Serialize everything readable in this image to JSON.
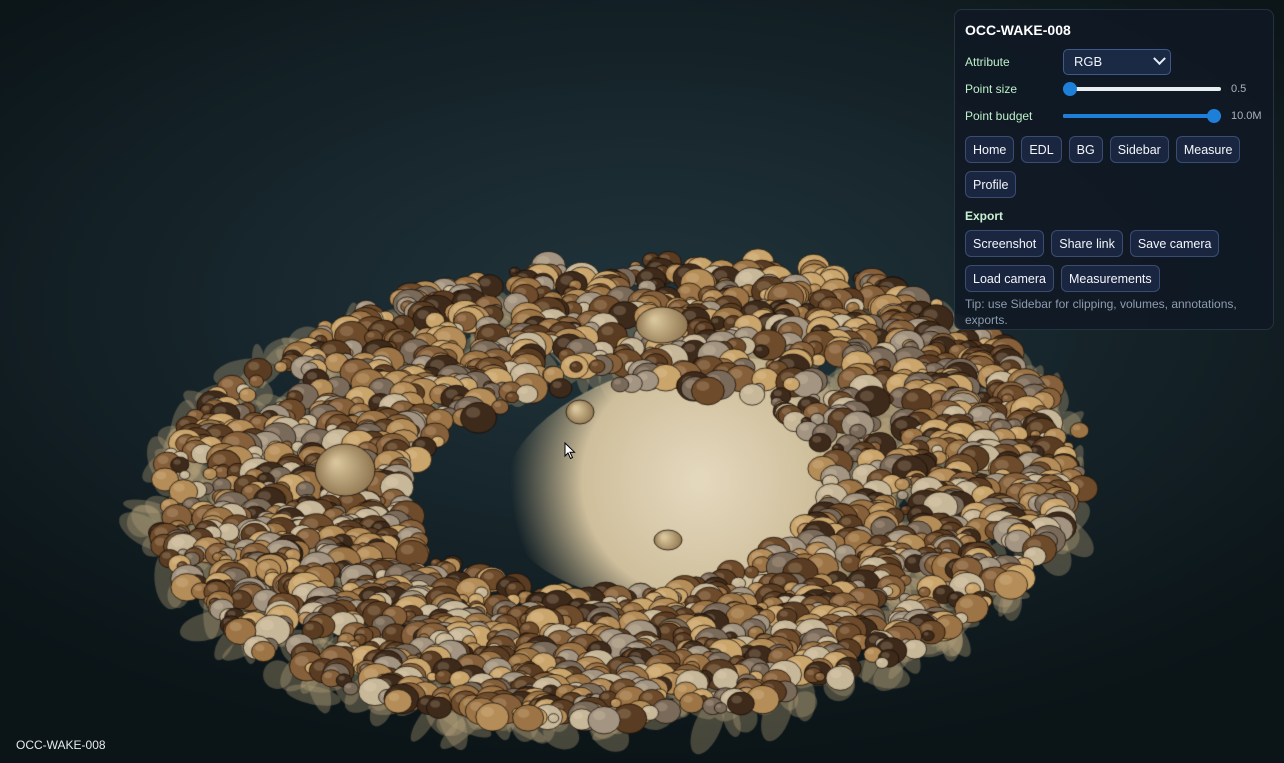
{
  "dataset_name": "OCC-WAKE-008",
  "controls": {
    "attribute_label": "Attribute",
    "attribute_value": "RGB",
    "point_size": {
      "label": "Point size",
      "value": 0.5,
      "fraction": 0.0,
      "value_text": "0.5"
    },
    "point_budget": {
      "label": "Point budget",
      "value": 10000000,
      "fraction": 1.0,
      "value_text": "10.0M"
    }
  },
  "toolbar": {
    "home": "Home",
    "edl": "EDL",
    "bg": "BG",
    "sidebar": "Sidebar",
    "measure": "Measure",
    "profile": "Profile"
  },
  "export": {
    "label": "Export",
    "screenshot": "Screenshot",
    "share_link": "Share link",
    "save_camera": "Save camera",
    "load_camera": "Load camera",
    "measurements": "Measurements"
  },
  "tip": "Tip: use Sidebar for clipping, volumes, annotations, exports.",
  "colors": {
    "accent": "#1e7fd8",
    "sand": "#d9c8a4",
    "coral_dark": "#4a3220",
    "coral_mid": "#8a6238",
    "coral_light": "#c9a46c"
  }
}
